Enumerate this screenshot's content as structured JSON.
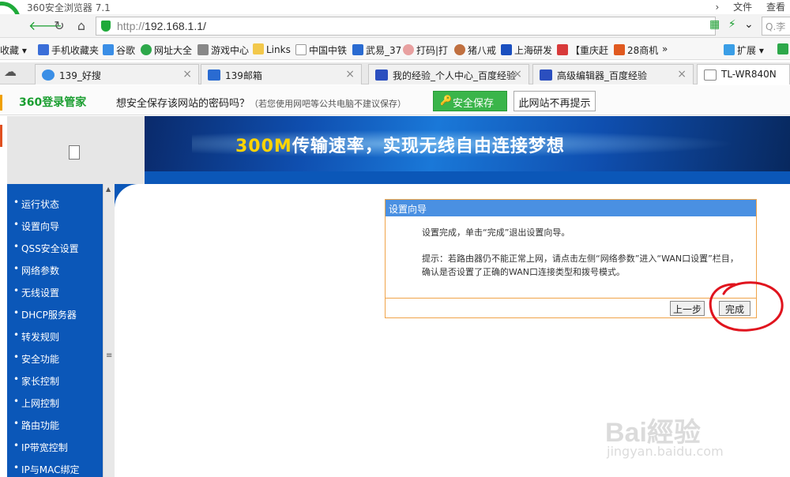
{
  "browser": {
    "title": "360安全浏览器 7.1",
    "menu": [
      "文件",
      "查看"
    ],
    "url_scheme": "http://",
    "url_host": "192.168.1.1/",
    "search_placeholder": "Q.李"
  },
  "bookmarks": {
    "favorites_label": "收藏",
    "items": [
      "手机收藏夹",
      "谷歌",
      "网址大全",
      "游戏中心",
      "Links",
      "中国中铁",
      "武易_37",
      "打码|打",
      "猪八戒",
      "上海研发",
      "【重庆赶",
      "28商机"
    ],
    "more": "»",
    "extend_label": "扩展"
  },
  "tabs": [
    {
      "label": "139_好搜",
      "icon_color": "#3a8ee6"
    },
    {
      "label": "139邮箱",
      "icon_color": "#2a6bd1"
    },
    {
      "label": "我的经验_个人中心_百度经验",
      "icon_color": "#2b4fbf"
    },
    {
      "label": "高级编辑器_百度经验",
      "icon_color": "#2b4fbf"
    },
    {
      "label": "TL-WR840N",
      "icon_color": "#ffffff"
    }
  ],
  "password_bar": {
    "brand": "360登录管家",
    "message": "想安全保存该网站的密码吗？",
    "note": "（若您使用网吧等公共电脑不建议保存）",
    "save_label": "安全保存",
    "never_label": "此网站不再提示"
  },
  "router": {
    "banner_num": "300M",
    "banner_text": "传输速率，实现无线自由连接梦想",
    "sidebar": [
      "运行状态",
      "设置向导",
      "QSS安全设置",
      "网络参数",
      "无线设置",
      "DHCP服务器",
      "转发规则",
      "安全功能",
      "家长控制",
      "上网控制",
      "路由功能",
      "IP带宽控制",
      "IP与MAC绑定"
    ],
    "dialog": {
      "title": "设置向导",
      "line1": "设置完成，单击“完成”退出设置向导。",
      "line2": "提示：若路由器仍不能正常上网，请点击左侧“网络参数”进入“WAN口设置”栏目，确认是否设置了正确的WAN口连接类型和拨号模式。",
      "prev_label": "上一步",
      "finish_label": "完成"
    }
  },
  "watermark": {
    "text": "Bai經验",
    "url": "jingyan.baidu.com"
  },
  "colors": {
    "router_blue": "#0b57b8",
    "dialog_title": "#4a90e2",
    "annotation_red": "#e0141e",
    "brand_green": "#1faa3a"
  }
}
